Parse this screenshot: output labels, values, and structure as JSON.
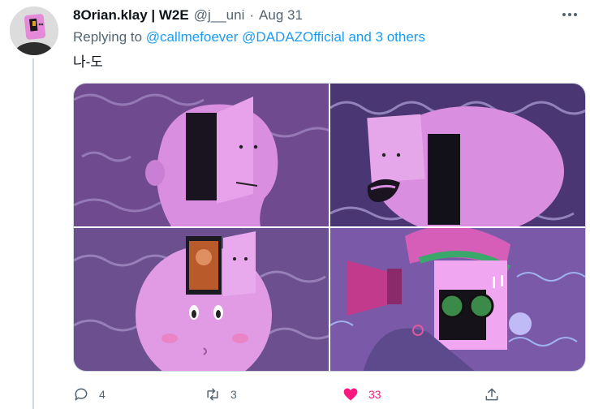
{
  "tweet": {
    "display_name": "8Orian.klay | W2E",
    "handle": "@j__uni",
    "separator": "·",
    "date": "Aug 31",
    "replying_prefix": "Replying to",
    "mentions": [
      "@callmefoever",
      "@DADAZOfficial"
    ],
    "others_text": "and 3 others",
    "text": "나-도"
  },
  "actions": {
    "reply_count": "4",
    "retweet_count": "3",
    "like_count": "33",
    "liked": true
  },
  "icons": {
    "more": "more-horizontal-icon",
    "reply": "speech-bubble-icon",
    "retweet": "retweet-arrows-icon",
    "like": "heart-icon",
    "share": "share-upload-icon"
  },
  "colors": {
    "text_primary": "#0f1419",
    "text_secondary": "#536471",
    "link": "#1d9bf0",
    "like": "#f91880",
    "art_purple": "#7a4e9c",
    "art_pink": "#e08be6"
  }
}
